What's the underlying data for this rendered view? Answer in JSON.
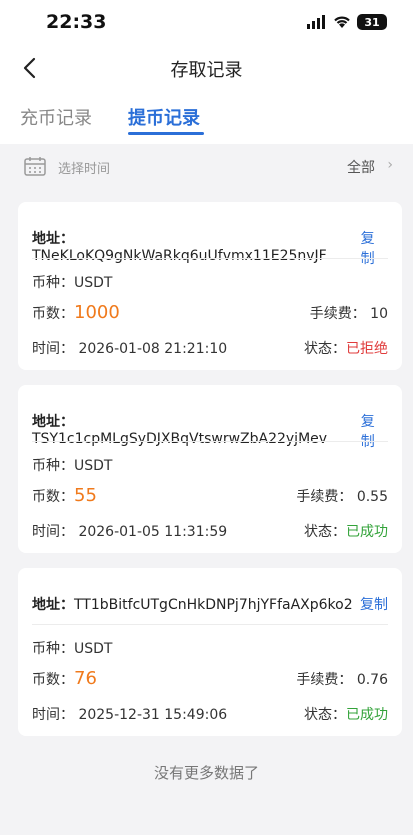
{
  "status_bar": {
    "time": "22:33",
    "battery": "31"
  },
  "nav": {
    "title": "存取记录"
  },
  "tabs": [
    {
      "label": "充币记录",
      "active": false
    },
    {
      "label": "提币记录",
      "active": true
    }
  ],
  "filter": {
    "placeholder": "选择时间",
    "value": "全部"
  },
  "labels": {
    "address": "地址：",
    "coin": "币种：",
    "amount": "币数：",
    "fee": "手续费：",
    "time": "时间：",
    "status": "状态：",
    "copy": "复制"
  },
  "records": [
    {
      "address": "TNeKLoKQ9gNkWaRkq6uUfvmx11E25nvJF",
      "coin": "USDT",
      "amount": "1000",
      "fee": "10",
      "time": "2026-01-08 21:21:10",
      "status": "已拒绝"
    },
    {
      "address": "TSY1c1cpMLgSyDJXBqVtswrwZbA22yjMev",
      "coin": "USDT",
      "amount": "55",
      "fee": "0.55",
      "time": "2026-01-05 11:31:59",
      "status": "已成功"
    },
    {
      "address": "TT1bBitfcUTgCnHkDNPj7hjYFfaAXp6ko2",
      "coin": "USDT",
      "amount": "76",
      "fee": "0.76",
      "time": "2025-12-31 15:49:06",
      "status": "已成功"
    }
  ],
  "footer": {
    "no_more": "没有更多数据了"
  },
  "colors": {
    "accent": "#2b6fd8",
    "amount": "#f07a1c",
    "rejected": "#e03b3b",
    "success": "#33a33a"
  }
}
